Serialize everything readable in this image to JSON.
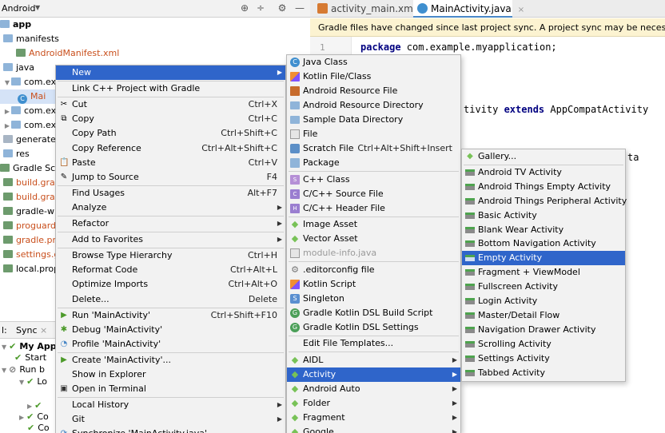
{
  "project_panel": {
    "title": "Android",
    "tree": [
      {
        "label": "app",
        "bold": true,
        "indent": 0,
        "icon": "folder",
        "twisty": ""
      },
      {
        "label": "manifests",
        "indent": 4,
        "icon": "folder",
        "twisty": ""
      },
      {
        "label": "AndroidManifest.xml",
        "indent": 20,
        "icon": "manifest",
        "twisty": "",
        "red": true
      },
      {
        "label": "java",
        "indent": 4,
        "icon": "folder",
        "twisty": ""
      },
      {
        "label": "com.ex",
        "indent": 4,
        "icon": "folder",
        "twisty": "▼"
      },
      {
        "label": "Mai",
        "indent": 22,
        "icon": "class",
        "twisty": "",
        "selected": true,
        "red": true
      },
      {
        "label": "com.ex",
        "indent": 4,
        "icon": "folder",
        "twisty": "▶"
      },
      {
        "label": "com.ex",
        "indent": 4,
        "icon": "folder",
        "twisty": "▶"
      },
      {
        "label": "generatec",
        "indent": 4,
        "icon": "gen",
        "twisty": ""
      },
      {
        "label": "res",
        "indent": 4,
        "icon": "folder",
        "twisty": ""
      },
      {
        "label": "Gradle Script",
        "indent": 0,
        "icon": "gradle",
        "twisty": ""
      },
      {
        "label": "build.grac",
        "indent": 4,
        "icon": "gradle",
        "twisty": "",
        "red": true
      },
      {
        "label": "build.grac",
        "indent": 4,
        "icon": "gradle",
        "twisty": "",
        "red": true
      },
      {
        "label": "gradle-wr",
        "indent": 4,
        "icon": "gradle",
        "twisty": ""
      },
      {
        "label": "proguard-",
        "indent": 4,
        "icon": "gradle",
        "twisty": "",
        "red": true
      },
      {
        "label": "gradle.pro",
        "indent": 4,
        "icon": "gradle",
        "twisty": "",
        "red": true
      },
      {
        "label": "settings.g",
        "indent": 4,
        "icon": "gradle",
        "twisty": "",
        "red": true
      },
      {
        "label": "local.prop",
        "indent": 4,
        "icon": "gradle",
        "twisty": ""
      }
    ]
  },
  "build_panel": {
    "tab_prefix": "l:",
    "tab_label": "Sync",
    "tab_close": "×",
    "rows": [
      {
        "label": "My App",
        "bold": true,
        "indent": 14,
        "mark": "✔",
        "twisty": "▼"
      },
      {
        "label": "Start",
        "indent": 30,
        "mark": "✔",
        "twisty": ""
      },
      {
        "label": "Run b",
        "indent": 14,
        "mark": "⊘",
        "twisty": "▼"
      },
      {
        "label": "Lo",
        "indent": 36,
        "mark": "✔",
        "twisty": "▼"
      },
      {
        "label": "",
        "indent": 36,
        "mark": "",
        "twisty": ""
      },
      {
        "label": "",
        "indent": 46,
        "mark": "✔",
        "twisty": "▶"
      },
      {
        "label": "Co",
        "indent": 36,
        "mark": "✔",
        "twisty": "▶"
      },
      {
        "label": "Co",
        "indent": 46,
        "mark": "✔",
        "twisty": ""
      }
    ]
  },
  "editor": {
    "tabs": [
      {
        "label": "activity_main.xml",
        "close": "×",
        "active": false
      },
      {
        "label": "MainActivity.java",
        "close": "×",
        "active": true
      }
    ],
    "banner": "Gradle files have changed since last project sync. A project sync may be necessary",
    "line1_no": "1",
    "line1_kw": "package",
    "line1_rest": " com.example.myapplication;",
    "line2_a": "tivity ",
    "line2_kw": "extends",
    "line2_b": " AppCompatActivity",
    "line3_frag": "ta"
  },
  "context_menu": {
    "items": [
      {
        "label": "New",
        "shortcut": "",
        "arrow": true,
        "highlighted": true
      },
      {
        "sep": true
      },
      {
        "label": "Link C++ Project with Gradle"
      },
      {
        "sep": true
      },
      {
        "label": "Cut",
        "shortcut": "Ctrl+X",
        "icon": "✂"
      },
      {
        "label": "Copy",
        "shortcut": "Ctrl+C",
        "icon": "⧉"
      },
      {
        "label": "Copy Path",
        "shortcut": "Ctrl+Shift+C"
      },
      {
        "label": "Copy Reference",
        "shortcut": "Ctrl+Alt+Shift+C"
      },
      {
        "label": "Paste",
        "shortcut": "Ctrl+V",
        "icon": "📋"
      },
      {
        "label": "Jump to Source",
        "shortcut": "F4",
        "icon": "✎"
      },
      {
        "sep": true
      },
      {
        "label": "Find Usages",
        "shortcut": "Alt+F7"
      },
      {
        "label": "Analyze",
        "arrow": true
      },
      {
        "sep": true
      },
      {
        "label": "Refactor",
        "arrow": true
      },
      {
        "sep": true
      },
      {
        "label": "Add to Favorites",
        "arrow": true
      },
      {
        "sep": true
      },
      {
        "label": "Browse Type Hierarchy",
        "shortcut": "Ctrl+H"
      },
      {
        "label": "Reformat Code",
        "shortcut": "Ctrl+Alt+L"
      },
      {
        "label": "Optimize Imports",
        "shortcut": "Ctrl+Alt+O"
      },
      {
        "label": "Delete...",
        "shortcut": "Delete"
      },
      {
        "sep": true
      },
      {
        "label": "Run 'MainActivity'",
        "shortcut": "Ctrl+Shift+F10",
        "icon": "▶",
        "icolor": "#4c9a2a"
      },
      {
        "label": "Debug 'MainActivity'",
        "icon": "✱",
        "icolor": "#4c9a2a"
      },
      {
        "label": "Profile 'MainActivity'",
        "icon": "◔",
        "icolor": "#4a88c7"
      },
      {
        "sep": true
      },
      {
        "label": "Create 'MainActivity'...",
        "icon": "▶",
        "icolor": "#4c9a2a"
      },
      {
        "label": "Show in Explorer"
      },
      {
        "label": "Open in Terminal",
        "icon": "▣",
        "icolor": "#333"
      },
      {
        "sep": true
      },
      {
        "label": "Local History",
        "arrow": true
      },
      {
        "label": "Git",
        "arrow": true
      },
      {
        "label": "Synchronize 'MainActivity.java'",
        "icon": "⟳",
        "icolor": "#4a88c7",
        "clipped": true
      }
    ]
  },
  "new_menu": {
    "items": [
      {
        "label": "Java Class",
        "ic": "java-c",
        "glyph": "C"
      },
      {
        "label": "Kotlin File/Class",
        "ic": "kt"
      },
      {
        "label": "Android Resource File",
        "ic": "res"
      },
      {
        "label": "Android Resource Directory",
        "ic": "fold"
      },
      {
        "label": "Sample Data Directory",
        "ic": "fold"
      },
      {
        "label": "File",
        "ic": "file"
      },
      {
        "label": "Scratch File",
        "ic": "scratch",
        "shortcut": "Ctrl+Alt+Shift+Insert"
      },
      {
        "label": "Package",
        "ic": "pkg"
      },
      {
        "sep": true
      },
      {
        "label": "C++ Class",
        "ic": "cpp",
        "glyph": "S"
      },
      {
        "label": "C/C++ Source File",
        "ic": "cpp2",
        "glyph": "C"
      },
      {
        "label": "C/C++ Header File",
        "ic": "cpp2",
        "glyph": "H"
      },
      {
        "sep": true
      },
      {
        "label": "Image Asset",
        "ic": "droid",
        "glyph": "◆"
      },
      {
        "label": "Vector Asset",
        "ic": "droid",
        "glyph": "◆"
      },
      {
        "label": "module-info.java",
        "disabled": true,
        "ic": "file"
      },
      {
        "sep": true
      },
      {
        "label": ".editorconfig file",
        "ic": "cfg",
        "glyph": "⚙"
      },
      {
        "label": "Kotlin Script",
        "ic": "kt"
      },
      {
        "label": "Singleton",
        "ic": "sing",
        "glyph": "S"
      },
      {
        "label": "Gradle Kotlin DSL Build Script",
        "ic": "gk",
        "glyph": "G"
      },
      {
        "label": "Gradle Kotlin DSL Settings",
        "ic": "gk",
        "glyph": "G"
      },
      {
        "sep": true
      },
      {
        "label": "Edit File Templates..."
      },
      {
        "sep": true
      },
      {
        "label": "AIDL",
        "ic": "droid",
        "glyph": "◆",
        "arrow": true
      },
      {
        "label": "Activity",
        "ic": "droid",
        "glyph": "◆",
        "arrow": true,
        "highlighted": true
      },
      {
        "label": "Android Auto",
        "ic": "droid",
        "glyph": "◆",
        "arrow": true
      },
      {
        "label": "Folder",
        "ic": "droid",
        "glyph": "◆",
        "arrow": true
      },
      {
        "label": "Fragment",
        "ic": "droid",
        "glyph": "◆",
        "arrow": true
      },
      {
        "label": "Google",
        "ic": "droid",
        "glyph": "◆",
        "arrow": true,
        "clipped": true
      }
    ]
  },
  "activity_menu": {
    "items": [
      {
        "label": "Gallery...",
        "ic": "gallery",
        "glyph": "◆"
      },
      {
        "sep": true
      },
      {
        "label": "Android TV Activity"
      },
      {
        "label": "Android Things Empty Activity"
      },
      {
        "label": "Android Things Peripheral Activity"
      },
      {
        "label": "Basic Activity"
      },
      {
        "label": "Blank Wear Activity"
      },
      {
        "label": "Bottom Navigation Activity"
      },
      {
        "label": "Empty Activity",
        "highlighted": true
      },
      {
        "label": "Fragment + ViewModel"
      },
      {
        "label": "Fullscreen Activity"
      },
      {
        "label": "Login Activity"
      },
      {
        "label": "Master/Detail Flow"
      },
      {
        "label": "Navigation Drawer Activity"
      },
      {
        "label": "Scrolling Activity"
      },
      {
        "label": "Settings Activity"
      },
      {
        "label": "Tabbed Activity"
      }
    ]
  }
}
